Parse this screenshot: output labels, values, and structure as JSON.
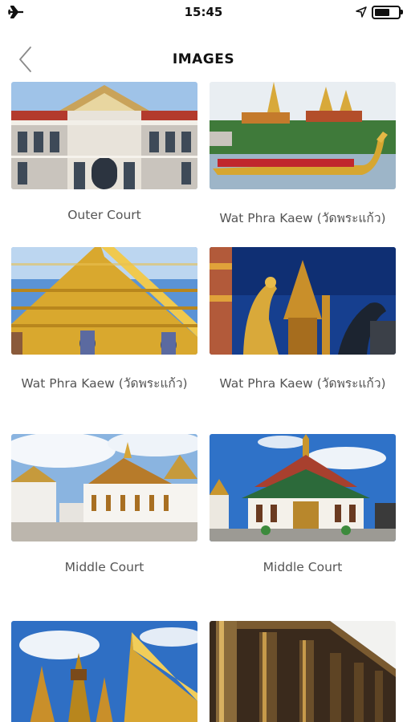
{
  "status_bar": {
    "time": "15:45",
    "icons": [
      "airplane-icon",
      "location-icon",
      "battery-icon"
    ]
  },
  "header": {
    "title": "IMAGES",
    "back_icon": "chevron-left-icon"
  },
  "images": [
    {
      "caption": "Outer Court"
    },
    {
      "caption": "Wat Phra Kaew (วัดพระแก้ว)"
    },
    {
      "caption": "Wat Phra Kaew (วัดพระแก้ว)"
    },
    {
      "caption": "Wat Phra Kaew (วัดพระแก้ว)"
    },
    {
      "caption": "Middle Court"
    },
    {
      "caption": "Middle Court"
    },
    {
      "caption": ""
    },
    {
      "caption": ""
    }
  ]
}
